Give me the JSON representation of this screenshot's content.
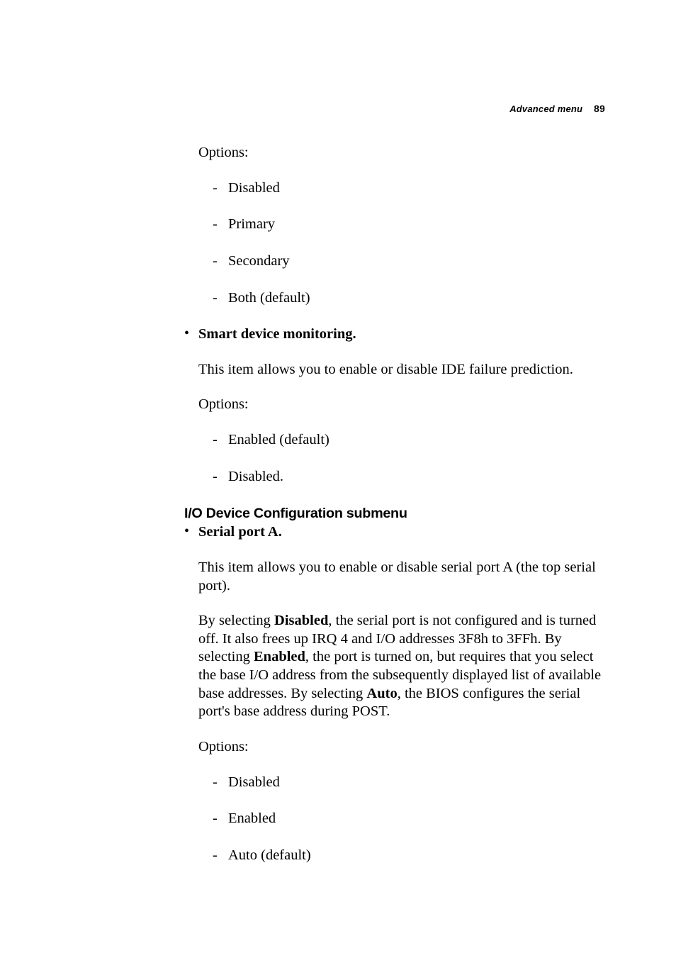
{
  "header": {
    "section": "Advanced menu",
    "pagenum": "89"
  },
  "block1": {
    "options_label": "Options:",
    "items": [
      "Disabled",
      "Primary",
      "Secondary",
      "Both (default)"
    ]
  },
  "smart": {
    "title": "Smart device monitoring.",
    "desc": "This item allows you to enable or disable IDE failure prediction.",
    "options_label": "Options:",
    "items": [
      "Enabled (default)",
      "Disabled."
    ]
  },
  "io_section": {
    "heading": "I/O Device Configuration submenu"
  },
  "serialA": {
    "title": "Serial port A.",
    "desc": "This item allows you to enable or disable serial port A (the top serial port).",
    "para_prefix": "By selecting ",
    "b1": "Disabled",
    "t1": ", the serial port is not configured and is turned off. It also frees up IRQ 4 and I/O addresses 3F8h to 3FFh. By selecting ",
    "b2": "Enabled",
    "t2": ", the port is turned on, but requires that you select the base I/O address from the subsequently displayed list of available base addresses. By selecting ",
    "b3": "Auto",
    "t3": ", the BIOS configures the serial port's base address during POST.",
    "options_label": "Options:",
    "items": [
      "Disabled",
      "Enabled",
      "Auto (default)"
    ]
  }
}
